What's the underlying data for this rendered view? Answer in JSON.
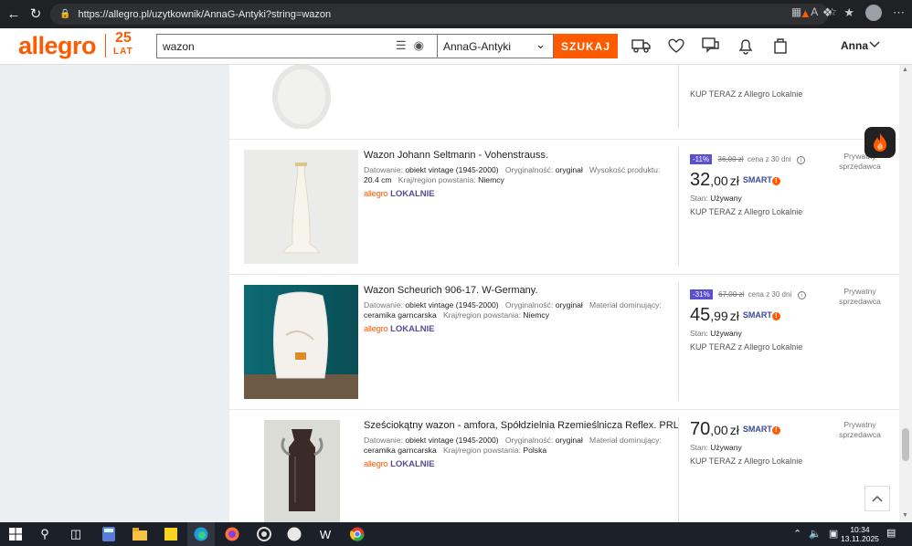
{
  "browser": {
    "url": "https://allegro.pl/uzytkownik/AnnaG-Antyki?string=wazon"
  },
  "header": {
    "logo": "allegro",
    "anniversary_top": "25",
    "anniversary_bottom": "LAT",
    "search_value": "wazon",
    "seller_filter": "AnnaG-Antyki",
    "search_button": "SZUKAJ",
    "user_name": "Anna"
  },
  "listings": [
    {
      "title": "",
      "params": [],
      "discount": "",
      "old_price": "",
      "price_int": "",
      "price_dec": "",
      "kup_teraz": "KUP TERAZ z Allegro Lokalnie"
    },
    {
      "title": "Wazon Johann Seltmann - Vohenstrauss.",
      "params_html": [
        {
          "label": "Datowanie:",
          "value": "obiekt vintage (1945-2000)"
        },
        {
          "label": "Oryginalność:",
          "value": "oryginał"
        },
        {
          "label": "Wysokość produktu:",
          "value": "20.4 cm"
        },
        {
          "label": "Kraj/region powstania:",
          "value": "Niemcy"
        }
      ],
      "brand_a": "allegro",
      "brand_l": "LOKALNIE",
      "discount": "-11%",
      "old_price": "36,00 zł",
      "old_label": "cena z 30 dni",
      "price_int": "32",
      "price_dec": ",00",
      "currency": "zł",
      "smart": "SMART",
      "stan_label": "Stan:",
      "stan_value": "Używany",
      "kup_teraz": "KUP TERAZ z Allegro Lokalnie",
      "seller_line1": "Prywatny",
      "seller_line2": "sprzedawca"
    },
    {
      "title": "Wazon Scheurich 906-17. W-Germany.",
      "params_html": [
        {
          "label": "Datowanie:",
          "value": "obiekt vintage (1945-2000)"
        },
        {
          "label": "Oryginalność:",
          "value": "oryginał"
        },
        {
          "label": "Materiał dominujący:",
          "value": "ceramika garncarska"
        },
        {
          "label": "Kraj/region powstania:",
          "value": "Niemcy"
        }
      ],
      "brand_a": "allegro",
      "brand_l": "LOKALNIE",
      "discount": "-31%",
      "old_price": "67,00 zł",
      "old_label": "cena z 30 dni",
      "price_int": "45",
      "price_dec": ",99",
      "currency": "zł",
      "smart": "SMART",
      "stan_label": "Stan:",
      "stan_value": "Używany",
      "kup_teraz": "KUP TERAZ z Allegro Lokalnie",
      "seller_line1": "Prywatny",
      "seller_line2": "sprzedawca"
    },
    {
      "title": "Sześciokątny wazon - amfora, Spółdzielnia Rzemieślnicza Reflex. PRL",
      "params_html": [
        {
          "label": "Datowanie:",
          "value": "obiekt vintage (1945-2000)"
        },
        {
          "label": "Oryginalność:",
          "value": "oryginał"
        },
        {
          "label": "Materiał dominujący:",
          "value": "ceramika garncarska"
        },
        {
          "label": "Kraj/region powstania:",
          "value": "Polska"
        }
      ],
      "brand_a": "allegro",
      "brand_l": "LOKALNIE",
      "price_int": "70",
      "price_dec": ",00",
      "currency": "zł",
      "smart": "SMART",
      "stan_label": "Stan:",
      "stan_value": "Używany",
      "kup_teraz": "KUP TERAZ z Allegro Lokalnie",
      "seller_line1": "Prywatny",
      "seller_line2": "sprzedawca"
    }
  ],
  "taskbar": {
    "time": "10:34",
    "date": "13.11.2025"
  },
  "colors": {
    "brand": "#ff5a00",
    "lokalnie": "#5a4a9b",
    "discount_badge": "#5a4fcf"
  }
}
